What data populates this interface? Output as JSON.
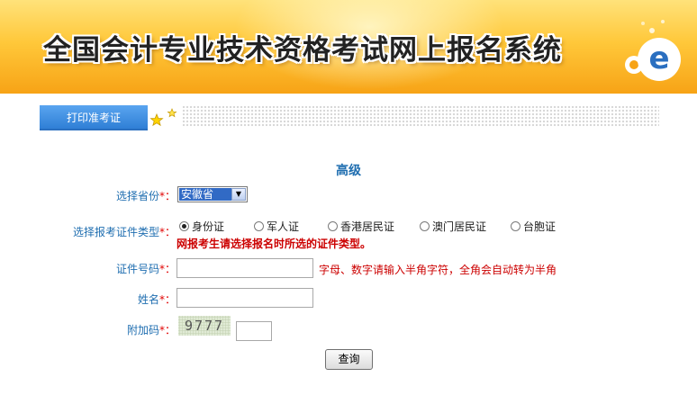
{
  "banner": {
    "title": "全国会计专业技术资格考试网上报名系统",
    "logo_letter": "e"
  },
  "tabs": [
    {
      "label": "打印准考证"
    }
  ],
  "form": {
    "level": "高级",
    "province_label": "选择省份",
    "province_value": "安徽省",
    "id_type_label": "选择报考证件类型",
    "id_types": [
      "身份证",
      "军人证",
      "香港居民证",
      "澳门居民证",
      "台胞证"
    ],
    "selected_id_type": "身份证",
    "id_type_warning": "网报考生请选择报名时所选的证件类型。",
    "id_number_label": "证件号码",
    "id_number_value": "",
    "id_number_hint": "字母、数字请输入半角字符，全角会自动转为半角",
    "name_label": "姓名",
    "name_value": "",
    "captcha_label": "附加码",
    "captcha_text": "9777",
    "captcha_value": "",
    "required_mark": "*：",
    "submit_label": "查询"
  },
  "colors": {
    "label_blue": "#1f6eb0",
    "required_red": "#e00000",
    "tab_blue": "#3a8ae0",
    "banner_orange": "#f7a316"
  }
}
